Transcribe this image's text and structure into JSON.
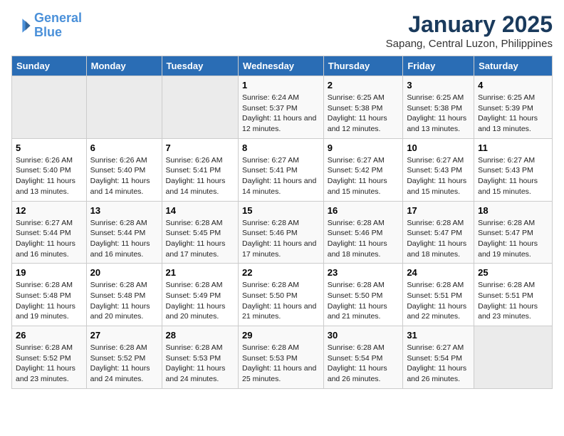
{
  "header": {
    "logo_line1": "General",
    "logo_line2": "Blue",
    "month": "January 2025",
    "location": "Sapang, Central Luzon, Philippines"
  },
  "weekdays": [
    "Sunday",
    "Monday",
    "Tuesday",
    "Wednesday",
    "Thursday",
    "Friday",
    "Saturday"
  ],
  "weeks": [
    [
      {
        "day": "",
        "sunrise": "",
        "sunset": "",
        "daylight": ""
      },
      {
        "day": "",
        "sunrise": "",
        "sunset": "",
        "daylight": ""
      },
      {
        "day": "",
        "sunrise": "",
        "sunset": "",
        "daylight": ""
      },
      {
        "day": "1",
        "sunrise": "Sunrise: 6:24 AM",
        "sunset": "Sunset: 5:37 PM",
        "daylight": "Daylight: 11 hours and 12 minutes."
      },
      {
        "day": "2",
        "sunrise": "Sunrise: 6:25 AM",
        "sunset": "Sunset: 5:38 PM",
        "daylight": "Daylight: 11 hours and 12 minutes."
      },
      {
        "day": "3",
        "sunrise": "Sunrise: 6:25 AM",
        "sunset": "Sunset: 5:38 PM",
        "daylight": "Daylight: 11 hours and 13 minutes."
      },
      {
        "day": "4",
        "sunrise": "Sunrise: 6:25 AM",
        "sunset": "Sunset: 5:39 PM",
        "daylight": "Daylight: 11 hours and 13 minutes."
      }
    ],
    [
      {
        "day": "5",
        "sunrise": "Sunrise: 6:26 AM",
        "sunset": "Sunset: 5:40 PM",
        "daylight": "Daylight: 11 hours and 13 minutes."
      },
      {
        "day": "6",
        "sunrise": "Sunrise: 6:26 AM",
        "sunset": "Sunset: 5:40 PM",
        "daylight": "Daylight: 11 hours and 14 minutes."
      },
      {
        "day": "7",
        "sunrise": "Sunrise: 6:26 AM",
        "sunset": "Sunset: 5:41 PM",
        "daylight": "Daylight: 11 hours and 14 minutes."
      },
      {
        "day": "8",
        "sunrise": "Sunrise: 6:27 AM",
        "sunset": "Sunset: 5:41 PM",
        "daylight": "Daylight: 11 hours and 14 minutes."
      },
      {
        "day": "9",
        "sunrise": "Sunrise: 6:27 AM",
        "sunset": "Sunset: 5:42 PM",
        "daylight": "Daylight: 11 hours and 15 minutes."
      },
      {
        "day": "10",
        "sunrise": "Sunrise: 6:27 AM",
        "sunset": "Sunset: 5:43 PM",
        "daylight": "Daylight: 11 hours and 15 minutes."
      },
      {
        "day": "11",
        "sunrise": "Sunrise: 6:27 AM",
        "sunset": "Sunset: 5:43 PM",
        "daylight": "Daylight: 11 hours and 15 minutes."
      }
    ],
    [
      {
        "day": "12",
        "sunrise": "Sunrise: 6:27 AM",
        "sunset": "Sunset: 5:44 PM",
        "daylight": "Daylight: 11 hours and 16 minutes."
      },
      {
        "day": "13",
        "sunrise": "Sunrise: 6:28 AM",
        "sunset": "Sunset: 5:44 PM",
        "daylight": "Daylight: 11 hours and 16 minutes."
      },
      {
        "day": "14",
        "sunrise": "Sunrise: 6:28 AM",
        "sunset": "Sunset: 5:45 PM",
        "daylight": "Daylight: 11 hours and 17 minutes."
      },
      {
        "day": "15",
        "sunrise": "Sunrise: 6:28 AM",
        "sunset": "Sunset: 5:46 PM",
        "daylight": "Daylight: 11 hours and 17 minutes."
      },
      {
        "day": "16",
        "sunrise": "Sunrise: 6:28 AM",
        "sunset": "Sunset: 5:46 PM",
        "daylight": "Daylight: 11 hours and 18 minutes."
      },
      {
        "day": "17",
        "sunrise": "Sunrise: 6:28 AM",
        "sunset": "Sunset: 5:47 PM",
        "daylight": "Daylight: 11 hours and 18 minutes."
      },
      {
        "day": "18",
        "sunrise": "Sunrise: 6:28 AM",
        "sunset": "Sunset: 5:47 PM",
        "daylight": "Daylight: 11 hours and 19 minutes."
      }
    ],
    [
      {
        "day": "19",
        "sunrise": "Sunrise: 6:28 AM",
        "sunset": "Sunset: 5:48 PM",
        "daylight": "Daylight: 11 hours and 19 minutes."
      },
      {
        "day": "20",
        "sunrise": "Sunrise: 6:28 AM",
        "sunset": "Sunset: 5:48 PM",
        "daylight": "Daylight: 11 hours and 20 minutes."
      },
      {
        "day": "21",
        "sunrise": "Sunrise: 6:28 AM",
        "sunset": "Sunset: 5:49 PM",
        "daylight": "Daylight: 11 hours and 20 minutes."
      },
      {
        "day": "22",
        "sunrise": "Sunrise: 6:28 AM",
        "sunset": "Sunset: 5:50 PM",
        "daylight": "Daylight: 11 hours and 21 minutes."
      },
      {
        "day": "23",
        "sunrise": "Sunrise: 6:28 AM",
        "sunset": "Sunset: 5:50 PM",
        "daylight": "Daylight: 11 hours and 21 minutes."
      },
      {
        "day": "24",
        "sunrise": "Sunrise: 6:28 AM",
        "sunset": "Sunset: 5:51 PM",
        "daylight": "Daylight: 11 hours and 22 minutes."
      },
      {
        "day": "25",
        "sunrise": "Sunrise: 6:28 AM",
        "sunset": "Sunset: 5:51 PM",
        "daylight": "Daylight: 11 hours and 23 minutes."
      }
    ],
    [
      {
        "day": "26",
        "sunrise": "Sunrise: 6:28 AM",
        "sunset": "Sunset: 5:52 PM",
        "daylight": "Daylight: 11 hours and 23 minutes."
      },
      {
        "day": "27",
        "sunrise": "Sunrise: 6:28 AM",
        "sunset": "Sunset: 5:52 PM",
        "daylight": "Daylight: 11 hours and 24 minutes."
      },
      {
        "day": "28",
        "sunrise": "Sunrise: 6:28 AM",
        "sunset": "Sunset: 5:53 PM",
        "daylight": "Daylight: 11 hours and 24 minutes."
      },
      {
        "day": "29",
        "sunrise": "Sunrise: 6:28 AM",
        "sunset": "Sunset: 5:53 PM",
        "daylight": "Daylight: 11 hours and 25 minutes."
      },
      {
        "day": "30",
        "sunrise": "Sunrise: 6:28 AM",
        "sunset": "Sunset: 5:54 PM",
        "daylight": "Daylight: 11 hours and 26 minutes."
      },
      {
        "day": "31",
        "sunrise": "Sunrise: 6:27 AM",
        "sunset": "Sunset: 5:54 PM",
        "daylight": "Daylight: 11 hours and 26 minutes."
      },
      {
        "day": "",
        "sunrise": "",
        "sunset": "",
        "daylight": ""
      }
    ]
  ]
}
